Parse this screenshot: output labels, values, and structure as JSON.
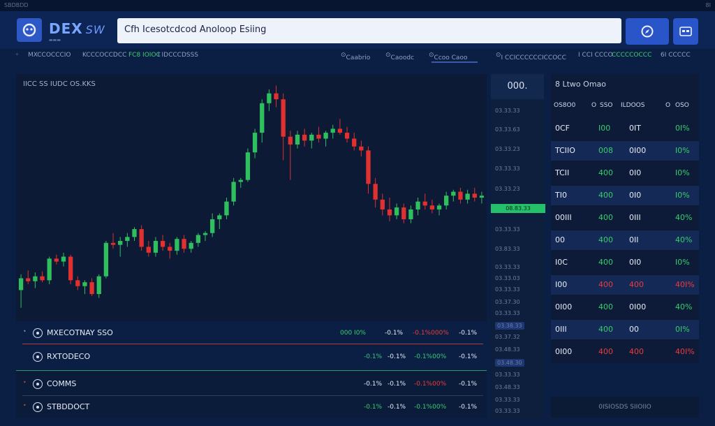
{
  "topbar": {
    "left_text": "SBDBDD",
    "right_text": "8I"
  },
  "header": {
    "logo_title": "DEX",
    "logo_suffix": "SW",
    "search_value": "Cfh Icesotcdcod Anoloop Esiing"
  },
  "subnav": [
    {
      "label": "MXCCOCCCIO",
      "style": "normal"
    },
    {
      "label": "KCCCOCCDCC",
      "style": "normal"
    },
    {
      "label": "FC8 IOIOC",
      "style": "green"
    },
    {
      "label": "I IDCCCDSSS",
      "style": "normal"
    },
    {
      "label": "Caabrio",
      "style": "normal"
    },
    {
      "label": "Caoodc",
      "style": "normal"
    },
    {
      "label": "Ccoo Caoo",
      "style": "normal"
    },
    {
      "label": "I CCICCCCCCICCOCC",
      "style": "normal"
    },
    {
      "label": "I CCI CCCO",
      "style": "normal"
    },
    {
      "label": "CCCCCOCCC",
      "style": "green"
    },
    {
      "label": "6I CCCCC",
      "style": "normal"
    }
  ],
  "chart": {
    "title": "IICC SS IUDC OS.KKS"
  },
  "chart_data": {
    "type": "candlestick",
    "title": "IICC SS IUDC OS.KKS",
    "candles": [
      {
        "o": 46,
        "h": 62,
        "l": 28,
        "c": 58
      },
      {
        "o": 58,
        "h": 66,
        "l": 52,
        "c": 55
      },
      {
        "o": 55,
        "h": 64,
        "l": 48,
        "c": 60
      },
      {
        "o": 60,
        "h": 65,
        "l": 54,
        "c": 56
      },
      {
        "o": 56,
        "h": 80,
        "l": 52,
        "c": 78
      },
      {
        "o": 78,
        "h": 82,
        "l": 72,
        "c": 75
      },
      {
        "o": 75,
        "h": 84,
        "l": 70,
        "c": 80
      },
      {
        "o": 80,
        "h": 82,
        "l": 52,
        "c": 56
      },
      {
        "o": 56,
        "h": 60,
        "l": 46,
        "c": 50
      },
      {
        "o": 50,
        "h": 56,
        "l": 42,
        "c": 54
      },
      {
        "o": 54,
        "h": 58,
        "l": 40,
        "c": 42
      },
      {
        "o": 42,
        "h": 62,
        "l": 38,
        "c": 60
      },
      {
        "o": 60,
        "h": 96,
        "l": 58,
        "c": 94
      },
      {
        "o": 94,
        "h": 104,
        "l": 88,
        "c": 92
      },
      {
        "o": 92,
        "h": 100,
        "l": 80,
        "c": 96
      },
      {
        "o": 96,
        "h": 104,
        "l": 90,
        "c": 100
      },
      {
        "o": 100,
        "h": 110,
        "l": 96,
        "c": 108
      },
      {
        "o": 108,
        "h": 112,
        "l": 86,
        "c": 90
      },
      {
        "o": 90,
        "h": 96,
        "l": 80,
        "c": 84
      },
      {
        "o": 84,
        "h": 100,
        "l": 80,
        "c": 96
      },
      {
        "o": 96,
        "h": 102,
        "l": 86,
        "c": 90
      },
      {
        "o": 90,
        "h": 94,
        "l": 78,
        "c": 86
      },
      {
        "o": 86,
        "h": 100,
        "l": 82,
        "c": 98
      },
      {
        "o": 98,
        "h": 102,
        "l": 84,
        "c": 88
      },
      {
        "o": 88,
        "h": 96,
        "l": 84,
        "c": 94
      },
      {
        "o": 94,
        "h": 104,
        "l": 90,
        "c": 102
      },
      {
        "o": 102,
        "h": 106,
        "l": 96,
        "c": 104
      },
      {
        "o": 104,
        "h": 124,
        "l": 100,
        "c": 118
      },
      {
        "o": 118,
        "h": 124,
        "l": 108,
        "c": 122
      },
      {
        "o": 122,
        "h": 140,
        "l": 118,
        "c": 136
      },
      {
        "o": 136,
        "h": 160,
        "l": 132,
        "c": 156
      },
      {
        "o": 156,
        "h": 160,
        "l": 150,
        "c": 158
      },
      {
        "o": 158,
        "h": 190,
        "l": 156,
        "c": 186
      },
      {
        "o": 186,
        "h": 210,
        "l": 180,
        "c": 206
      },
      {
        "o": 206,
        "h": 240,
        "l": 196,
        "c": 236
      },
      {
        "o": 236,
        "h": 250,
        "l": 228,
        "c": 246
      },
      {
        "o": 246,
        "h": 254,
        "l": 232,
        "c": 240
      },
      {
        "o": 240,
        "h": 246,
        "l": 178,
        "c": 202
      },
      {
        "o": 202,
        "h": 208,
        "l": 158,
        "c": 194
      },
      {
        "o": 194,
        "h": 208,
        "l": 190,
        "c": 204
      },
      {
        "o": 204,
        "h": 210,
        "l": 192,
        "c": 198
      },
      {
        "o": 198,
        "h": 206,
        "l": 190,
        "c": 204
      },
      {
        "o": 204,
        "h": 212,
        "l": 196,
        "c": 200
      },
      {
        "o": 200,
        "h": 208,
        "l": 192,
        "c": 206
      },
      {
        "o": 206,
        "h": 214,
        "l": 200,
        "c": 210
      },
      {
        "o": 210,
        "h": 220,
        "l": 204,
        "c": 206
      },
      {
        "o": 206,
        "h": 212,
        "l": 196,
        "c": 200
      },
      {
        "o": 200,
        "h": 206,
        "l": 188,
        "c": 192
      },
      {
        "o": 192,
        "h": 198,
        "l": 182,
        "c": 188
      },
      {
        "o": 188,
        "h": 192,
        "l": 144,
        "c": 154
      },
      {
        "o": 154,
        "h": 160,
        "l": 130,
        "c": 138
      },
      {
        "o": 138,
        "h": 144,
        "l": 122,
        "c": 128
      },
      {
        "o": 128,
        "h": 140,
        "l": 116,
        "c": 122
      },
      {
        "o": 122,
        "h": 134,
        "l": 118,
        "c": 130
      },
      {
        "o": 130,
        "h": 134,
        "l": 114,
        "c": 118
      },
      {
        "o": 118,
        "h": 132,
        "l": 114,
        "c": 128
      },
      {
        "o": 128,
        "h": 140,
        "l": 122,
        "c": 136
      },
      {
        "o": 136,
        "h": 144,
        "l": 128,
        "c": 132
      },
      {
        "o": 132,
        "h": 138,
        "l": 124,
        "c": 128
      },
      {
        "o": 128,
        "h": 134,
        "l": 122,
        "c": 132
      },
      {
        "o": 132,
        "h": 146,
        "l": 128,
        "c": 142
      },
      {
        "o": 142,
        "h": 148,
        "l": 136,
        "c": 146
      },
      {
        "o": 146,
        "h": 150,
        "l": 134,
        "c": 138
      },
      {
        "o": 138,
        "h": 148,
        "l": 134,
        "c": 144
      },
      {
        "o": 144,
        "h": 150,
        "l": 136,
        "c": 140
      },
      {
        "o": 140,
        "h": 146,
        "l": 134,
        "c": 142
      }
    ],
    "ylim": [
      20,
      260
    ],
    "colors": {
      "up": "#2fbf5f",
      "down": "#e0302f"
    }
  },
  "axis": {
    "top_value": "000.",
    "ticks": [
      "03.33.33",
      "03.33.63",
      "03.33.23",
      "03.33.33",
      "03.33.23",
      "03.33.33",
      "03.83.33",
      "03.33.33",
      "03.33.03",
      "03.33.33",
      "03.37.30",
      "03.33.33",
      "03.37.32",
      "03.48.33",
      "03.33.33",
      "03.48.33",
      "03.33.33",
      "03.33.33",
      "03.33.33",
      "03.33.33",
      "03.33.33"
    ],
    "current_price": "08.83.33",
    "highlight_1": "03.38.33",
    "highlight_2": "03.48.30"
  },
  "orderbook": {
    "title": "8 Ltwo Omao",
    "headers": [
      "OS8O0",
      "O",
      "SSO",
      "ILDOOS",
      "O",
      "OSO"
    ],
    "rows": [
      {
        "a": "0CF",
        "b": "I00",
        "c": "0IT",
        "d": "0I%",
        "b_color": "g",
        "c_color": "w",
        "d_color": "g"
      },
      {
        "a": "TCIIO",
        "b": "008",
        "c": "0I00",
        "d": "I0%",
        "b_color": "g",
        "c_color": "w",
        "d_color": "g"
      },
      {
        "a": "TCII",
        "b": "400",
        "c": "0I0",
        "d": "I0%",
        "b_color": "g",
        "c_color": "w",
        "d_color": "g"
      },
      {
        "a": "TI0",
        "b": "400",
        "c": "0I0",
        "d": "I0%",
        "b_color": "g",
        "c_color": "w",
        "d_color": "g"
      },
      {
        "a": "00III",
        "b": "400",
        "c": "0III",
        "d": "40%",
        "b_color": "g",
        "c_color": "w",
        "d_color": "g"
      },
      {
        "a": "00",
        "b": "400",
        "c": "0II",
        "d": "40%",
        "b_color": "g",
        "c_color": "w",
        "d_color": "g"
      },
      {
        "a": "I0C",
        "b": "400",
        "c": "0I0",
        "d": "I0%",
        "b_color": "g",
        "c_color": "w",
        "d_color": "g"
      },
      {
        "a": "I00",
        "b": "400",
        "c": "400",
        "d": "40I%",
        "b_color": "r",
        "c_color": "r",
        "d_color": "r"
      },
      {
        "a": "0I00",
        "b": "400",
        "c": "0I00",
        "d": "40%",
        "b_color": "g",
        "c_color": "w",
        "d_color": "g"
      },
      {
        "a": "0III",
        "b": "400",
        "c": "00",
        "d": "0I%",
        "b_color": "g",
        "c_color": "w",
        "d_color": "g"
      },
      {
        "a": "0I00",
        "b": "400",
        "c": "400",
        "d": "40I%",
        "b_color": "r",
        "c_color": "r",
        "d_color": "r"
      }
    ],
    "footer": "0ISIOSDS SIIOIIO"
  },
  "assets": [
    {
      "name": "MXECOTNAY SSO",
      "v1": "000 I0%",
      "v2": "-0.1%",
      "v3": "-0.1%000%",
      "v4": "-0.1%",
      "v1_color": "g",
      "v3_color": "r",
      "line_color": "#b83a3a"
    },
    {
      "name": "RXTODECO",
      "v1": "-0.1%",
      "v2": "-0.1%",
      "v3": "-0.1%00%",
      "v4": "-0.1%",
      "v1_color": "g",
      "v3_color": "g",
      "line_color": "#2a3e63"
    },
    {
      "name": "COMMS",
      "v1": "-0.1%",
      "v2": "-0.1%",
      "v3": "-0.1%00%",
      "v4": "-0.1%",
      "v1_color": "w",
      "v3_color": "r",
      "line_color": "#2b9a58"
    },
    {
      "name": "STBDDOCT",
      "v1": "-0.1%",
      "v2": "-0.1%",
      "v3": "-0.1%00%",
      "v4": "-0.1%",
      "v1_color": "g",
      "v3_color": "g",
      "line_color": "#2a3e63"
    }
  ]
}
